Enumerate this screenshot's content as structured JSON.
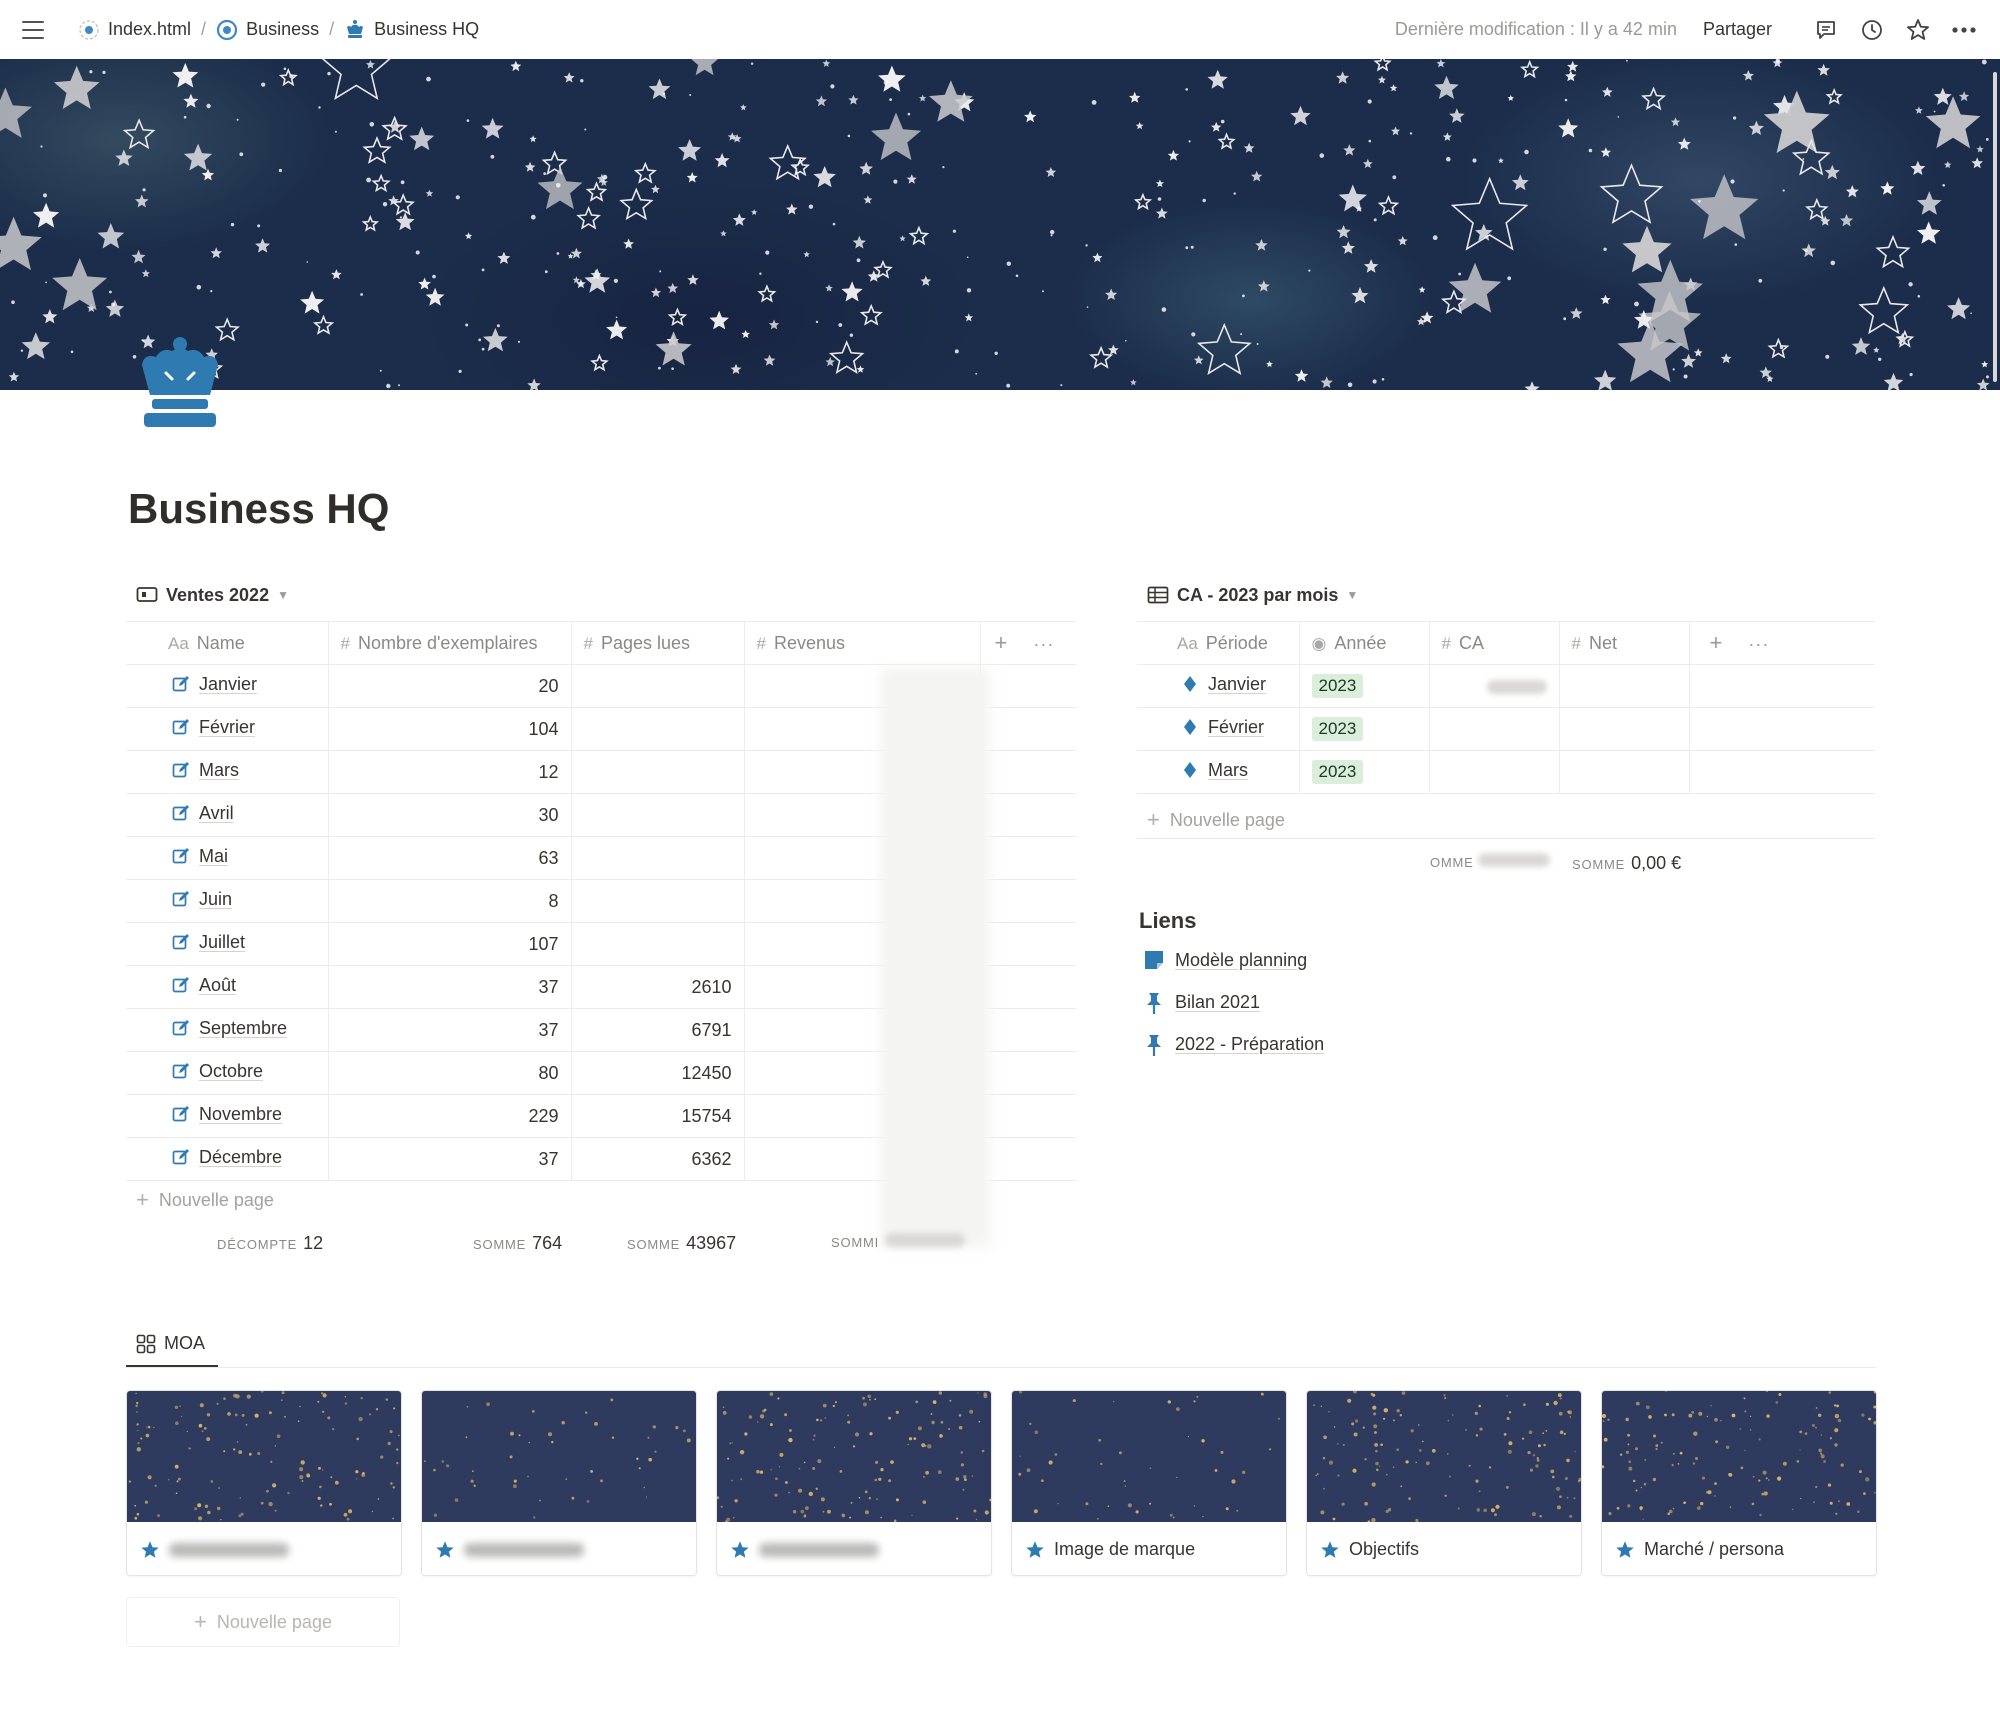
{
  "breadcrumb": [
    {
      "label": "Index.html"
    },
    {
      "label": "Business"
    },
    {
      "label": "Business HQ"
    }
  ],
  "topbar": {
    "last_modified": "Dernière modification : Il y a 42 min",
    "share": "Partager"
  },
  "page": {
    "title": "Business HQ"
  },
  "sales": {
    "title": "Ventes 2022",
    "columns": [
      {
        "icon": "Aa",
        "label": "Name"
      },
      {
        "icon": "#",
        "label": "Nombre d'exemplaires"
      },
      {
        "icon": "#",
        "label": "Pages lues"
      },
      {
        "icon": "#",
        "label": "Revenus"
      }
    ],
    "rows": [
      {
        "name": "Janvier",
        "copies": "20",
        "pages": ""
      },
      {
        "name": "Février",
        "copies": "104",
        "pages": ""
      },
      {
        "name": "Mars",
        "copies": "12",
        "pages": ""
      },
      {
        "name": "Avril",
        "copies": "30",
        "pages": ""
      },
      {
        "name": "Mai",
        "copies": "63",
        "pages": ""
      },
      {
        "name": "Juin",
        "copies": "8",
        "pages": ""
      },
      {
        "name": "Juillet",
        "copies": "107",
        "pages": ""
      },
      {
        "name": "Août",
        "copies": "37",
        "pages": "2610"
      },
      {
        "name": "Septembre",
        "copies": "37",
        "pages": "6791"
      },
      {
        "name": "Octobre",
        "copies": "80",
        "pages": "12450"
      },
      {
        "name": "Novembre",
        "copies": "229",
        "pages": "15754"
      },
      {
        "name": "Décembre",
        "copies": "37",
        "pages": "6362"
      }
    ],
    "new_page": "Nouvelle page",
    "footer": {
      "count_label": "DÉCOMPTE",
      "count_value": "12",
      "sum1_label": "SOMME",
      "sum1_value": "764",
      "sum2_label": "SOMME",
      "sum2_value": "43967",
      "sum3_label": "SOMMI"
    }
  },
  "ca": {
    "title": "CA - 2023 par mois",
    "columns": [
      {
        "icon": "Aa",
        "label": "Période"
      },
      {
        "icon": "◉",
        "label": "Année"
      },
      {
        "icon": "#",
        "label": "CA"
      },
      {
        "icon": "#",
        "label": "Net"
      }
    ],
    "rows": [
      {
        "period": "Janvier",
        "year": "2023"
      },
      {
        "period": "Février",
        "year": "2023"
      },
      {
        "period": "Mars",
        "year": "2023"
      }
    ],
    "new_page": "Nouvelle page",
    "footer": {
      "sum1_label": "OMME",
      "sum2_label": "SOMME",
      "sum2_value": "0,00 €"
    }
  },
  "links": {
    "title": "Liens",
    "items": [
      {
        "label": "Modèle planning",
        "icon": "note-icon"
      },
      {
        "label": "Bilan 2021",
        "icon": "pin-icon"
      },
      {
        "label": "2022 - Préparation",
        "icon": "pin-icon"
      }
    ]
  },
  "moa": {
    "tab": "MOA",
    "cards": [
      {
        "label": ""
      },
      {
        "label": ""
      },
      {
        "label": ""
      },
      {
        "label": "Image de marque"
      },
      {
        "label": "Objectifs"
      },
      {
        "label": "Marché / persona"
      }
    ],
    "new_page": "Nouvelle page"
  },
  "colors": {
    "accent": "#2f7bb1",
    "cover": "#1b2d4a",
    "pill_bg": "#dbeddb"
  }
}
